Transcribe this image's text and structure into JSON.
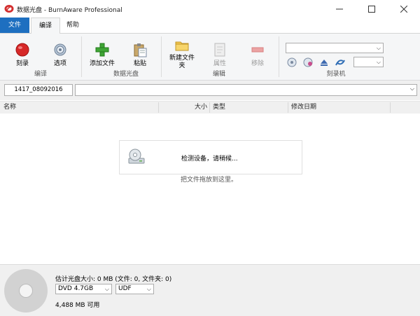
{
  "window": {
    "title": "数据光盘 - BurnAware Professional",
    "accent": "#1e6fc0",
    "minimize_icon": "minimize-icon",
    "maximize_icon": "maximize-icon",
    "close_icon": "close-icon"
  },
  "tabs": [
    {
      "label": "文件"
    },
    {
      "label": "编译"
    },
    {
      "label": "帮助"
    }
  ],
  "ribbon": {
    "groups": [
      {
        "label": "编译",
        "buttons": [
          {
            "label": "刻录",
            "icon": "record-icon"
          },
          {
            "label": "选项",
            "icon": "gear-icon"
          }
        ]
      },
      {
        "label": "数据光盘",
        "buttons": [
          {
            "label": "添加文件",
            "icon": "add-icon"
          },
          {
            "label": "粘贴",
            "icon": "paste-icon"
          }
        ]
      },
      {
        "label": "编辑",
        "buttons": [
          {
            "label": "新建文件夹",
            "icon": "new-folder-icon"
          },
          {
            "label": "属性",
            "icon": "properties-icon"
          },
          {
            "label": "移除",
            "icon": "remove-icon"
          }
        ]
      },
      {
        "label": "刻录机"
      }
    ],
    "recorder_select": "",
    "speed_select": ""
  },
  "path": {
    "disc_label": "1417_08092016",
    "current_path": ""
  },
  "columns": {
    "name": "名称",
    "size": "大小",
    "type": "类型",
    "modified": "修改日期"
  },
  "content": {
    "status": "检测设备，请稍候...",
    "drop_hint": "把文件拖放到这里。"
  },
  "bottom": {
    "estimated_size": "估计光盘大小: 0 MB (文件: 0, 文件夹: 0)",
    "disc_type": "DVD 4.7GB",
    "file_system": "UDF",
    "available": "4,488 MB 可用"
  }
}
